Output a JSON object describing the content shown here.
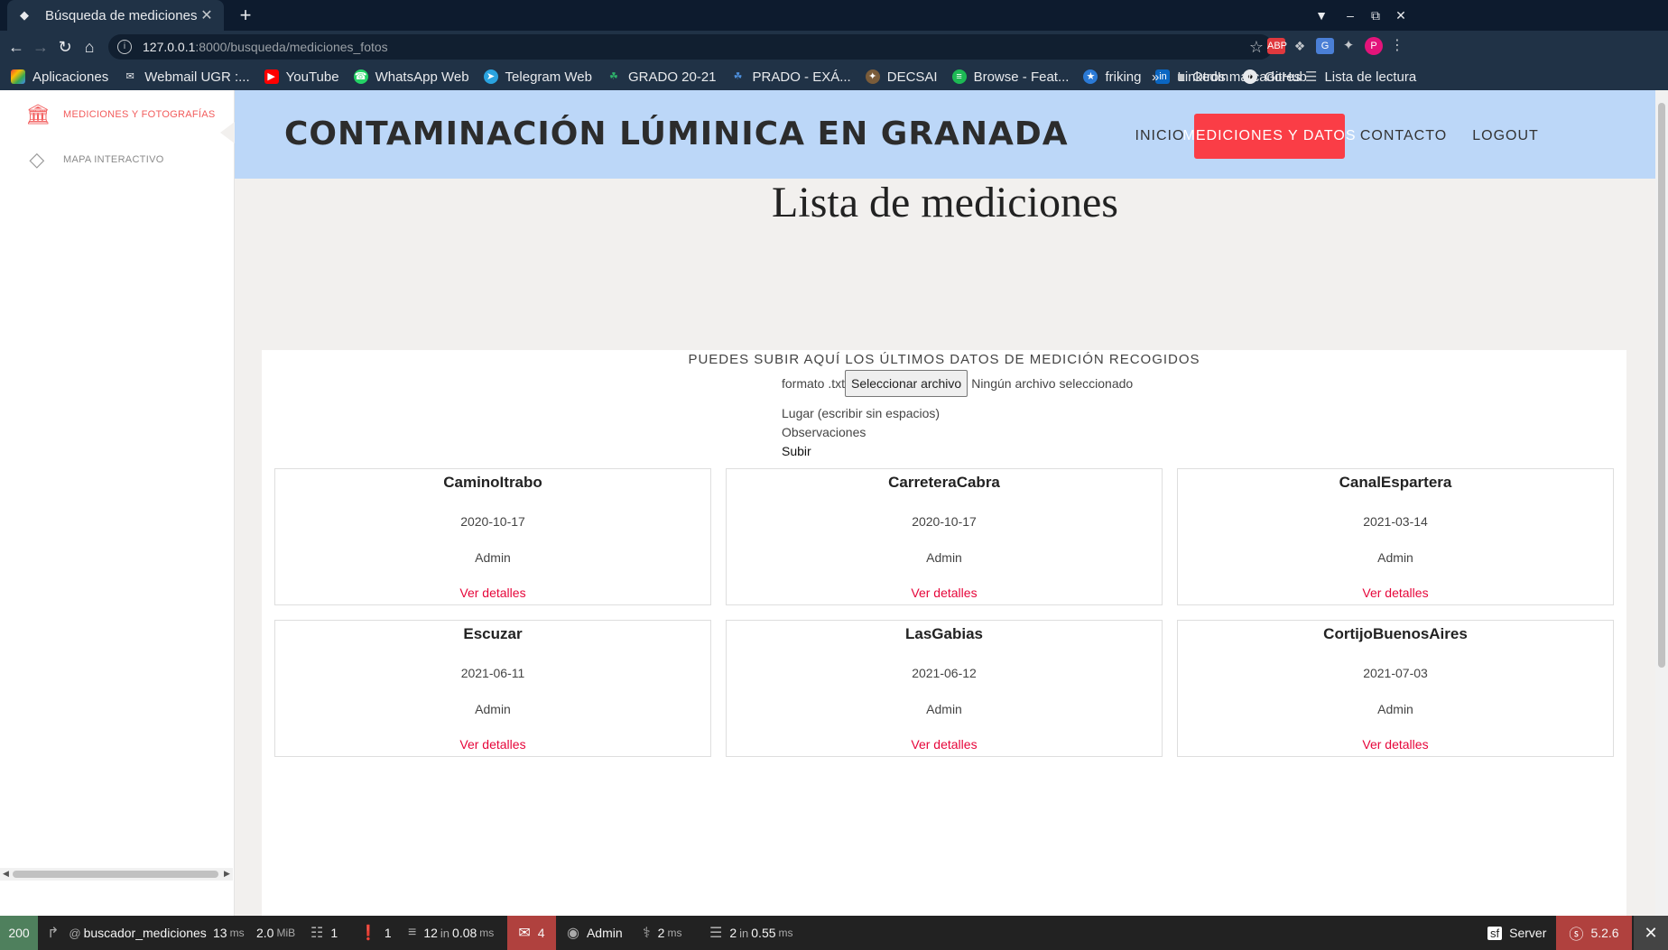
{
  "browser": {
    "tab_title": "Búsqueda de mediciones",
    "url_host": "127.0.0.1",
    "url_path": ":8000/busqueda/mediciones_fotos",
    "bookmarks": [
      "Aplicaciones",
      "Webmail UGR :...",
      "YouTube",
      "WhatsApp Web",
      "Telegram Web",
      "GRADO 20-21",
      "PRADO - EXÁ...",
      "DECSAI",
      "Browse - Feat...",
      "friking",
      "LinkedIn",
      "GitHub"
    ],
    "bookmarks_more": "»",
    "other_bookmarks": "Otros marcadores",
    "reading_list": "Lista de lectura",
    "ext_abp": "ABP",
    "profile_initial": "P"
  },
  "sidebar": {
    "items": [
      {
        "label": "MEDICIONES Y FOTOGRAFÍAS",
        "icon": "bank-icon",
        "active": true
      },
      {
        "label": "MAPA INTERACTIVO",
        "icon": "diamond-icon",
        "active": false
      }
    ]
  },
  "header": {
    "brand": "CONTAMINACIÓN LÚMINICA EN GRANADA",
    "nav": [
      "INICIO",
      "MEDICIONES Y DATOS",
      "CONTACTO",
      "LOGOUT"
    ],
    "active_color": "#fa3d46",
    "bg_color": "#bcd7f8"
  },
  "main": {
    "title": "Lista de mediciones",
    "upload": {
      "heading": "PUEDES SUBIR AQUÍ LOS ÚLTIMOS DATOS DE MEDICIÓN RECOGIDOS",
      "format_label": "formato .txt",
      "file_button": "Seleccionar archivo",
      "file_status": "Ningún archivo seleccionado",
      "place_label": "Lugar (escribir sin espacios)",
      "obs_label": "Observaciones",
      "submit_label": "Subir"
    },
    "cards": [
      {
        "place": "CaminoItrabo",
        "date": "2020-10-17",
        "user": "Admin",
        "link": "Ver detalles"
      },
      {
        "place": "CarreteraCabra",
        "date": "2020-10-17",
        "user": "Admin",
        "link": "Ver detalles"
      },
      {
        "place": "CanalEspartera",
        "date": "2021-03-14",
        "user": "Admin",
        "link": "Ver detalles"
      },
      {
        "place": "Escuzar",
        "date": "2021-06-11",
        "user": "Admin",
        "link": "Ver detalles"
      },
      {
        "place": "LasGabias",
        "date": "2021-06-12",
        "user": "Admin",
        "link": "Ver detalles"
      },
      {
        "place": "CortijoBuenosAires",
        "date": "2021-07-03",
        "user": "Admin",
        "link": "Ver detalles"
      }
    ]
  },
  "debugbar": {
    "status": "200",
    "route": "buscador_mediciones",
    "time_value": "13",
    "time_unit": "ms",
    "memory_value": "2.0",
    "memory_unit": "MiB",
    "forms": "1",
    "validator": "1",
    "cache_count": "12",
    "cache_in": "in",
    "cache_time": "0.08",
    "cache_unit": "ms",
    "messages": "4",
    "user": "Admin",
    "twig_time": "2",
    "twig_unit": "ms",
    "db_count": "2",
    "db_in": "in",
    "db_time": "0.55",
    "db_unit": "ms",
    "server": "Server",
    "version": "5.2.6"
  }
}
